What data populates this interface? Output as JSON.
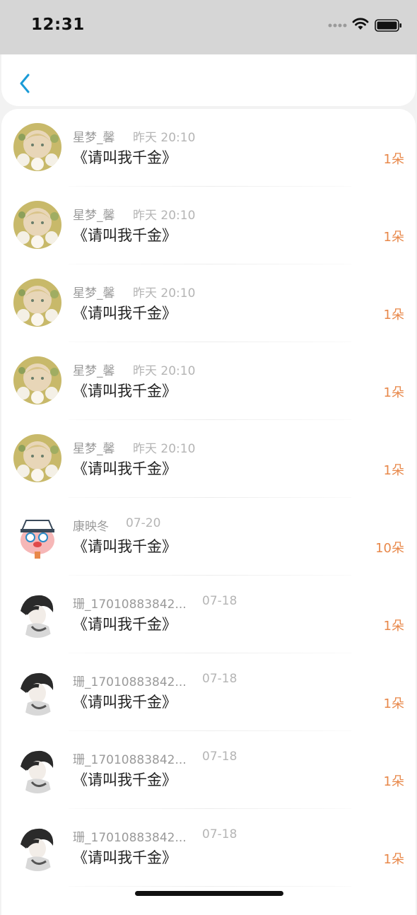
{
  "status_bar": {
    "time": "12:31"
  },
  "nav": {
    "back_icon": "chevron-left-icon"
  },
  "colors": {
    "accent_blue": "#1a9bd7",
    "count_orange": "#e8884a"
  },
  "gifts": [
    {
      "avatar": "anime-girl",
      "name": "星梦_馨",
      "time": "昨天 20:10",
      "title": "《请叫我千金》",
      "count": "1朵"
    },
    {
      "avatar": "anime-girl",
      "name": "星梦_馨",
      "time": "昨天 20:10",
      "title": "《请叫我千金》",
      "count": "1朵"
    },
    {
      "avatar": "anime-girl",
      "name": "星梦_馨",
      "time": "昨天 20:10",
      "title": "《请叫我千金》",
      "count": "1朵"
    },
    {
      "avatar": "anime-girl",
      "name": "星梦_馨",
      "time": "昨天 20:10",
      "title": "《请叫我千金》",
      "count": "1朵"
    },
    {
      "avatar": "anime-girl",
      "name": "星梦_馨",
      "time": "昨天 20:10",
      "title": "《请叫我千金》",
      "count": "1朵"
    },
    {
      "avatar": "cartoon-boy",
      "name": "康映冬",
      "time": "07-20",
      "title": "《请叫我千金》",
      "count": "10朵"
    },
    {
      "avatar": "sketch-boy",
      "name": "珊_17010883842...",
      "time": "07-18",
      "title": "《请叫我千金》",
      "count": "1朵"
    },
    {
      "avatar": "sketch-boy",
      "name": "珊_17010883842...",
      "time": "07-18",
      "title": "《请叫我千金》",
      "count": "1朵"
    },
    {
      "avatar": "sketch-boy",
      "name": "珊_17010883842...",
      "time": "07-18",
      "title": "《请叫我千金》",
      "count": "1朵"
    },
    {
      "avatar": "sketch-boy",
      "name": "珊_17010883842...",
      "time": "07-18",
      "title": "《请叫我千金》",
      "count": "1朵"
    }
  ]
}
